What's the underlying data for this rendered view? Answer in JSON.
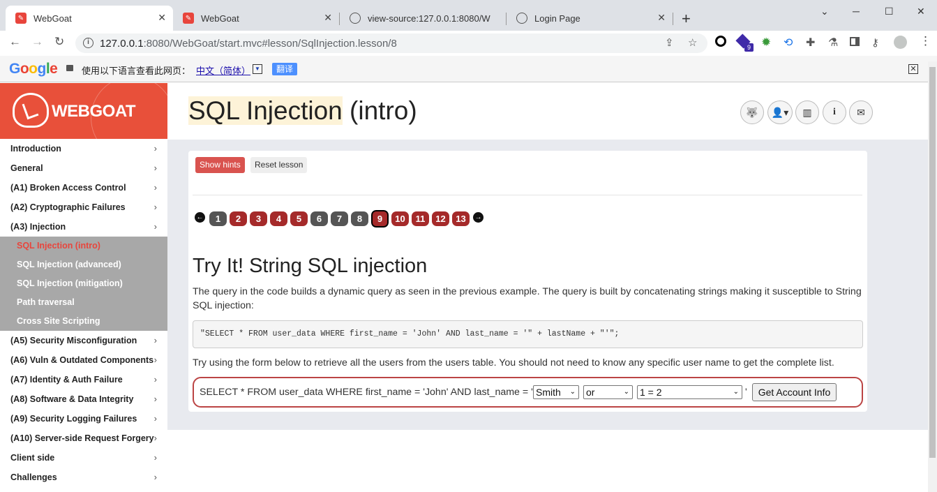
{
  "browser": {
    "tabs": [
      {
        "title": "WebGoat",
        "icon": "webgoat-favicon",
        "active": true
      },
      {
        "title": "WebGoat",
        "icon": "webgoat-favicon",
        "active": false
      },
      {
        "title": "view-source:127.0.0.1:8080/W",
        "icon": "globe-icon",
        "active": false
      },
      {
        "title": "Login Page",
        "icon": "globe-icon",
        "active": false
      }
    ],
    "close_glyph": "✕",
    "new_tab_glyph": "+",
    "window_controls": [
      "⌄",
      "─",
      "☐",
      "✕"
    ],
    "url_host": "127.0.0.1",
    "url_rest": ":8080/WebGoat/start.mvc#lesson/SqlInjection.lesson/8",
    "extension_badge": "9"
  },
  "translate_bar": {
    "logo": [
      "G",
      "o",
      "o",
      "g",
      "l",
      "e"
    ],
    "message": "使用以下语言查看此网页：",
    "language": "中文（简体）",
    "dropdown_glyph": "▼",
    "button": "翻译",
    "close_glyph": "✕"
  },
  "sidebar": {
    "brand": "WEBGOAT",
    "items_top": [
      "Introduction",
      "General",
      "(A1) Broken Access Control",
      "(A2) Cryptographic Failures",
      "(A3) Injection"
    ],
    "sub_items": [
      {
        "label": "SQL Injection (intro)",
        "active": true
      },
      {
        "label": "SQL Injection (advanced)",
        "active": false
      },
      {
        "label": "SQL Injection (mitigation)",
        "active": false
      },
      {
        "label": "Path traversal",
        "active": false
      },
      {
        "label": "Cross Site Scripting",
        "active": false
      }
    ],
    "items_bottom": [
      "(A5) Security Misconfiguration",
      "(A6) Vuln & Outdated Components",
      "(A7) Identity & Auth Failure",
      "(A8) Software & Data Integrity",
      "(A9) Security Logging Failures",
      "(A10) Server-side Request Forgery",
      "Client side",
      "Challenges"
    ],
    "chevron": "›"
  },
  "header": {
    "title_highlight": "SQL Injection",
    "title_rest": " (intro)",
    "buttons": [
      "wolf-icon",
      "user-menu-icon",
      "stats-icon",
      "info-icon",
      "mail-icon"
    ]
  },
  "lesson": {
    "show_hints": "Show hints",
    "reset_lesson": "Reset lesson",
    "pages": [
      "1",
      "2",
      "3",
      "4",
      "5",
      "6",
      "7",
      "8",
      "9",
      "10",
      "11",
      "12",
      "13"
    ],
    "current_page": "9",
    "prev_glyph": "←",
    "next_glyph": "→",
    "heading": "Try It! String SQL injection",
    "intro": "The query in the code builds a dynamic query as seen in the previous example. The query is built by concatenating strings making it susceptible to String SQL injection:",
    "code": "\"SELECT * FROM user_data WHERE first_name = 'John' AND last_name = '\" + lastName + \"'\";",
    "instruction": "Try using the form below to retrieve all the users from the users table. You should not need to know any specific user name to get the complete list.",
    "form": {
      "prefix": "SELECT * FROM user_data WHERE first_name = 'John' AND last_name = '",
      "select1": "Smith",
      "select2": "or",
      "select3": "1 = 2",
      "suffix": "'",
      "button": "Get Account Info",
      "select_arrow": "⌄"
    }
  },
  "colors": {
    "brand": "#e8503a",
    "hint_button": "#d9534f",
    "page_active": "#a52a2a",
    "page_inactive": "#555555",
    "submenu_bg": "#a8a8a8"
  }
}
